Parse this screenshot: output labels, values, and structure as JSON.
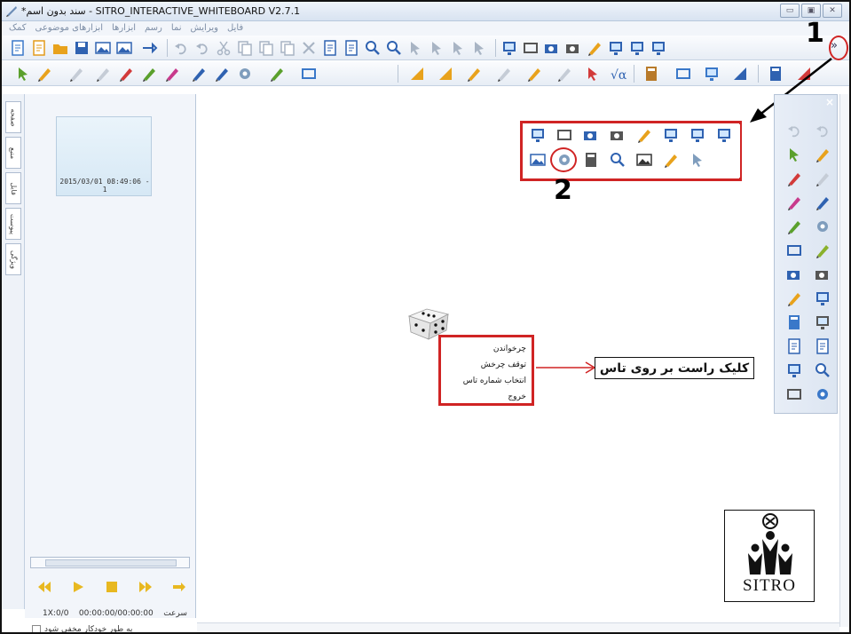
{
  "window": {
    "title": "*سند بدون اسم - SITRO_INTERACTIVE_WHITEBOARD V2.7.1",
    "controls": [
      "minimize",
      "maximize",
      "close"
    ]
  },
  "menu": {
    "items": [
      "فایل",
      "ویرایش",
      "نما",
      "رسم",
      "ابزارها",
      "ابزارهای موضوعی",
      "کمک"
    ]
  },
  "left_tabs": [
    "صفحه",
    "منبع",
    "فایل",
    "پیوست",
    "ویژگی"
  ],
  "page_panel": {
    "thumbnail_label": "2015/03/01 08:49:06 - 1",
    "playback_time": "00:00:00/00:00:00",
    "speed_label": "1X:سرعت",
    "page_count": "0/0",
    "autohide_label": "به طور خودکار مخفی شود"
  },
  "annotations": {
    "step1": "1",
    "step2": "2",
    "context_hint": "کلیک راست بر روی تاس"
  },
  "context_menu": {
    "items": [
      "چرخواندن",
      "توقف چرخش",
      "انتخاب شماره تاس",
      "خروج"
    ]
  },
  "logo": {
    "text": "SITRO"
  },
  "colors": {
    "highlight": "#d02424",
    "toolbar_bg": "#e7edf5",
    "panel_bg": "#f2f5fa"
  }
}
